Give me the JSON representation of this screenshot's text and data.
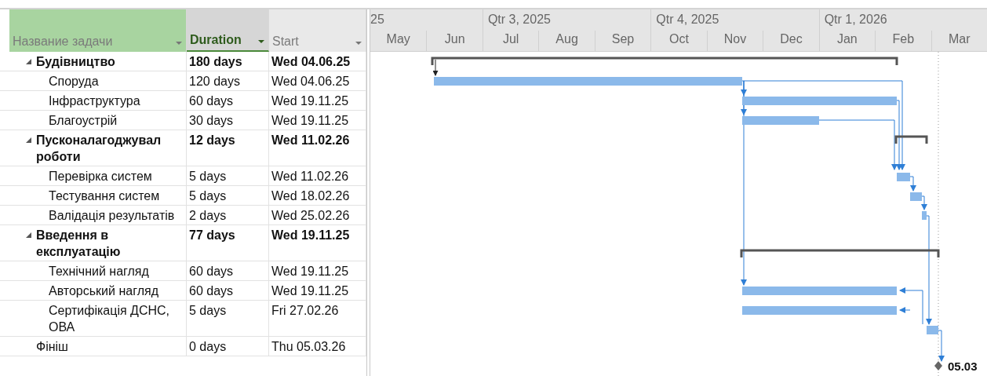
{
  "table": {
    "columns": [
      {
        "label": "Название задачи",
        "kind": "name"
      },
      {
        "label": "Duration",
        "kind": "duration"
      },
      {
        "label": "Start",
        "kind": "start"
      }
    ],
    "tasks": [
      {
        "name": "Будівництво",
        "duration": "180 days",
        "start": "Wed 04.06.25",
        "expanded": true,
        "children": [
          {
            "name": "Споруда",
            "duration": "120 days",
            "start": "Wed 04.06.25"
          },
          {
            "name": "Інфраструктура",
            "duration": "60 days",
            "start": "Wed 19.11.25"
          },
          {
            "name": "Благоустрій",
            "duration": "30 days",
            "start": "Wed 19.11.25"
          }
        ]
      },
      {
        "name": "Пусконалагоджувал роботи",
        "duration": "12 days",
        "start": "Wed 11.02.26",
        "expanded": true,
        "children": [
          {
            "name": "Перевірка систем",
            "duration": "5 days",
            "start": "Wed 11.02.26"
          },
          {
            "name": "Тестування систем",
            "duration": "5 days",
            "start": "Wed 18.02.26"
          },
          {
            "name": "Валідація результатів",
            "duration": "2 days",
            "start": "Wed 25.02.26"
          }
        ]
      },
      {
        "name": "Введення в експлуатацію",
        "duration": "77 days",
        "start": "Wed 19.11.25",
        "expanded": true,
        "children": [
          {
            "name": "Технічний нагляд",
            "duration": "60 days",
            "start": "Wed 19.11.25"
          },
          {
            "name": "Авторський нагляд",
            "duration": "60 days",
            "start": "Wed 19.11.25"
          },
          {
            "name": "Сертифікація ДСНС, ОВА",
            "duration": "5 days",
            "start": "Fri 27.02.26"
          }
        ]
      },
      {
        "name": "Фініш",
        "duration": "0 days",
        "start": "Thu 05.03.26"
      }
    ]
  },
  "gantt": {
    "quarters": [
      {
        "label": "25",
        "months": [
          "May",
          "Jun"
        ]
      },
      {
        "label": "Qtr 3, 2025",
        "months": [
          "Jul",
          "Aug",
          "Sep"
        ]
      },
      {
        "label": "Qtr 4, 2025",
        "months": [
          "Oct",
          "Nov",
          "Dec"
        ]
      },
      {
        "label": "Qtr 1, 2026",
        "months": [
          "Jan",
          "Feb",
          "Mar"
        ]
      }
    ],
    "milestone_label": "05.03"
  }
}
